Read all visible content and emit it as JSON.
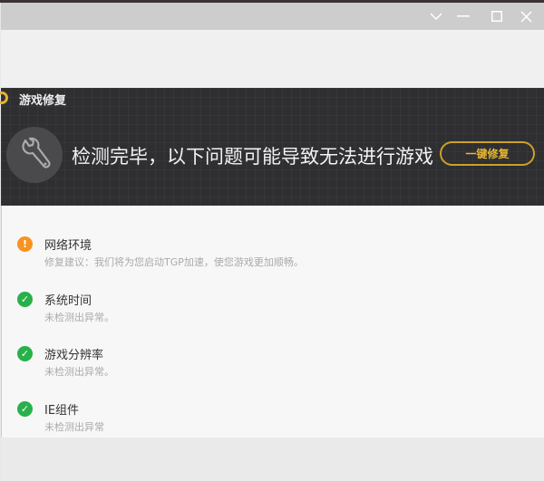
{
  "window": {
    "controls": [
      "dropdown",
      "minimize",
      "maximize",
      "close"
    ]
  },
  "banner": {
    "title": "游戏修复",
    "headline": "检测完毕，以下问题可能导致无法进行游戏",
    "fix_button": "一键修复",
    "accent_color": "#e2b22e"
  },
  "items": [
    {
      "name": "网络环境",
      "desc": "修复建议：我们将为您启动TGP加速，使您游戏更加顺畅。",
      "status": "warning",
      "color": "#f7931e"
    },
    {
      "name": "系统时间",
      "desc": "未检测出异常。",
      "status": "ok",
      "color": "#27b14a"
    },
    {
      "name": "游戏分辨率",
      "desc": "未检测出异常。",
      "status": "ok",
      "color": "#27b14a"
    },
    {
      "name": "IE组件",
      "desc": "未检测出异常",
      "status": "ok",
      "color": "#27b14a"
    }
  ]
}
